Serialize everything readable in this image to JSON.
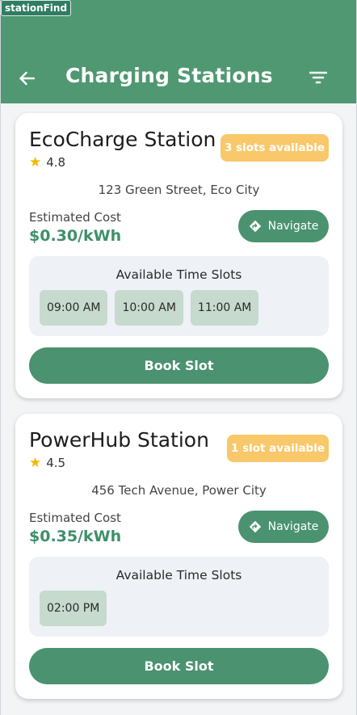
{
  "app_tag": "stationFind",
  "appbar": {
    "title": "Charging Stations"
  },
  "stations": [
    {
      "name": "EcoCharge Station",
      "rating": "4.8",
      "badge": "3 slots available",
      "address": "123 Green Street, Eco City",
      "cost_label": "Estimated Cost",
      "cost_value": "$0.30/kWh",
      "navigate_label": "Navigate",
      "slots_title": "Available Time Slots",
      "slots": [
        "09:00 AM",
        "10:00 AM",
        "11:00 AM"
      ],
      "book_label": "Book Slot"
    },
    {
      "name": "PowerHub Station",
      "rating": "4.5",
      "badge": "1 slot available",
      "address": "456 Tech Avenue, Power City",
      "cost_label": "Estimated Cost",
      "cost_value": "$0.35/kWh",
      "navigate_label": "Navigate",
      "slots_title": "Available Time Slots",
      "slots": [
        "02:00 PM"
      ],
      "book_label": "Book Slot"
    }
  ],
  "colors": {
    "primary": "#4f9872",
    "button": "#4a9270",
    "badge": "#f8c86a",
    "slot_chip": "#c6dace",
    "star": "#f5b800"
  }
}
